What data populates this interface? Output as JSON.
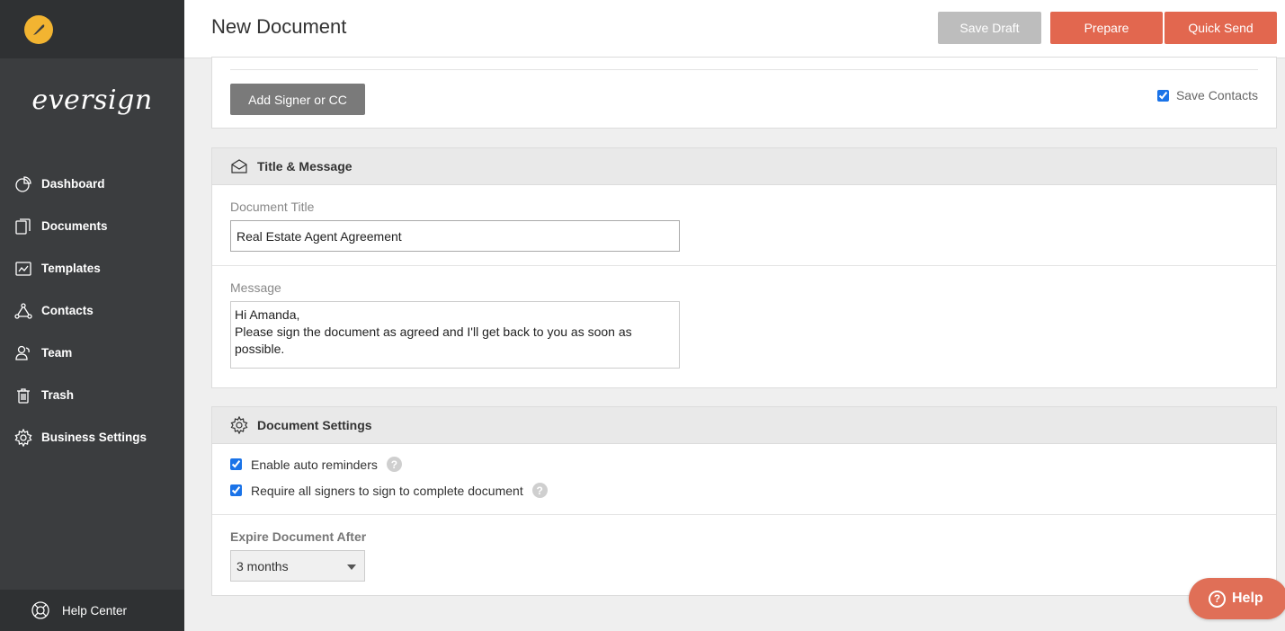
{
  "sidebar": {
    "brand": "eversign",
    "items": [
      {
        "label": "Dashboard",
        "icon": "pie-chart-icon"
      },
      {
        "label": "Documents",
        "icon": "documents-icon"
      },
      {
        "label": "Templates",
        "icon": "templates-icon"
      },
      {
        "label": "Contacts",
        "icon": "contacts-icon"
      },
      {
        "label": "Team",
        "icon": "team-icon"
      },
      {
        "label": "Trash",
        "icon": "trash-icon"
      },
      {
        "label": "Business Settings",
        "icon": "gear-icon"
      }
    ],
    "help_center": "Help Center"
  },
  "header": {
    "title": "New Document",
    "save_draft": "Save Draft",
    "prepare": "Prepare",
    "quick_send": "Quick Send"
  },
  "signers": {
    "add_button": "Add Signer or CC",
    "save_contacts_label": "Save Contacts",
    "save_contacts_checked": true
  },
  "title_message": {
    "heading": "Title & Message",
    "doc_title_label": "Document Title",
    "doc_title_value": "Real Estate Agent Agreement",
    "message_label": "Message",
    "message_value": "Hi Amanda,\nPlease sign the document as agreed and I'll get back to you as soon as possible."
  },
  "settings": {
    "heading": "Document Settings",
    "auto_reminders_label": "Enable auto reminders",
    "require_all_label": "Require all signers to sign to complete document",
    "expire_label": "Expire Document After",
    "expire_value": "3 months"
  },
  "help_bubble": "Help",
  "colors": {
    "accent": "#e2674f",
    "sidebar": "#3b3d3f",
    "logo": "#f2b431"
  }
}
